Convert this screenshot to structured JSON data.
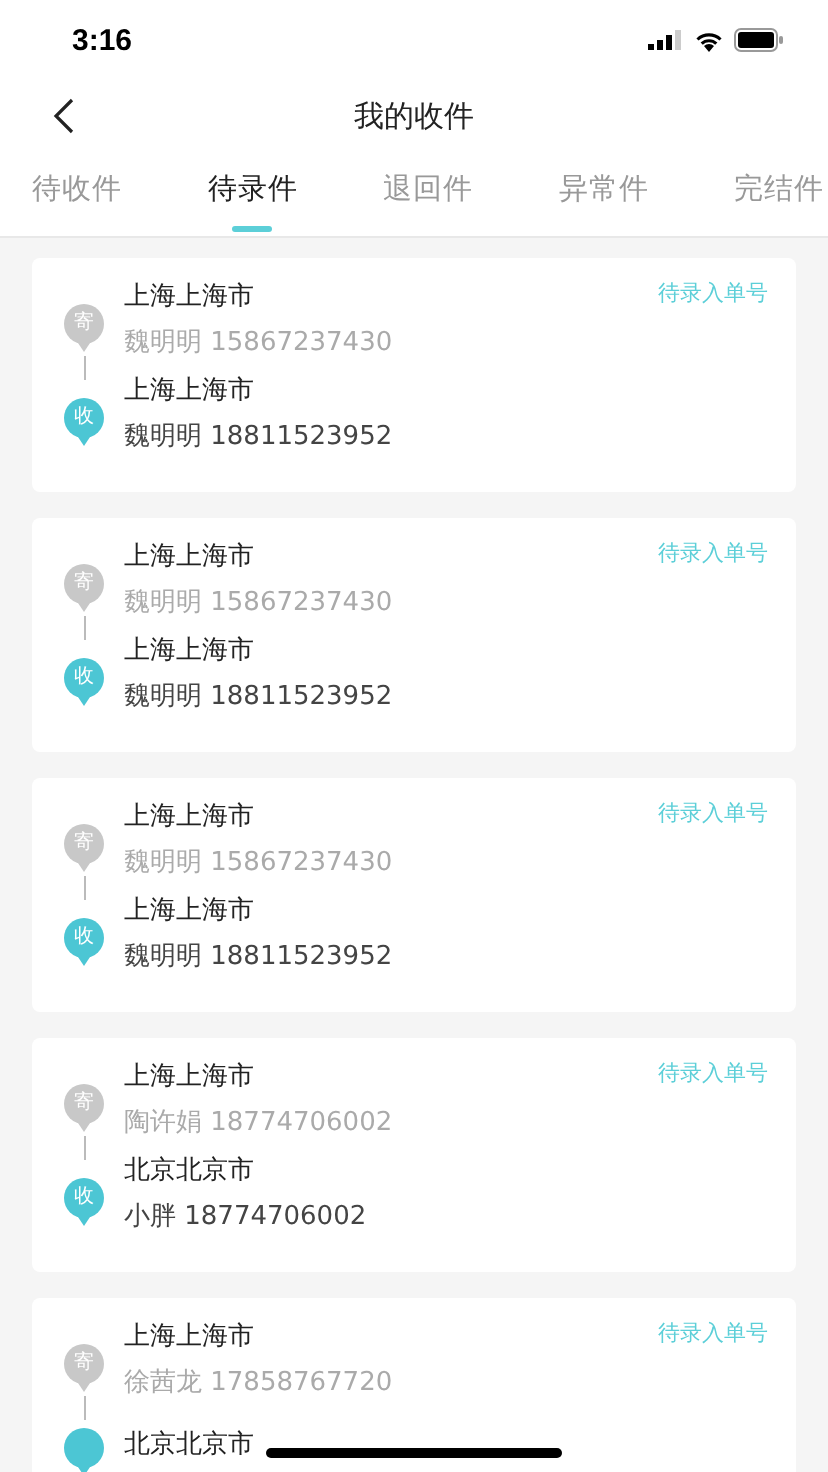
{
  "status_bar": {
    "time": "3:16"
  },
  "nav": {
    "title": "我的收件"
  },
  "tabs": [
    {
      "label": "待收件",
      "selected": false
    },
    {
      "label": "待录件",
      "selected": true
    },
    {
      "label": "退回件",
      "selected": false
    },
    {
      "label": "异常件",
      "selected": false
    },
    {
      "label": "完结件",
      "selected": false
    }
  ],
  "parcels": [
    {
      "status": "待录入单号",
      "stops": [
        {
          "kind": "sender",
          "badge": "寄",
          "city": "上海上海市",
          "contact": "魏明明 15867237430"
        },
        {
          "kind": "receiver",
          "badge": "收",
          "city": "上海上海市",
          "contact": "魏明明 18811523952"
        }
      ]
    },
    {
      "status": "待录入单号",
      "stops": [
        {
          "kind": "sender",
          "badge": "寄",
          "city": "上海上海市",
          "contact": "魏明明 15867237430"
        },
        {
          "kind": "receiver",
          "badge": "收",
          "city": "上海上海市",
          "contact": "魏明明 18811523952"
        }
      ]
    },
    {
      "status": "待录入单号",
      "stops": [
        {
          "kind": "sender",
          "badge": "寄",
          "city": "上海上海市",
          "contact": "魏明明 15867237430"
        },
        {
          "kind": "receiver",
          "badge": "收",
          "city": "上海上海市",
          "contact": "魏明明 18811523952"
        }
      ]
    },
    {
      "status": "待录入单号",
      "stops": [
        {
          "kind": "sender",
          "badge": "寄",
          "city": "上海上海市",
          "contact": "陶许娟 18774706002"
        },
        {
          "kind": "receiver",
          "badge": "收",
          "city": "北京北京市",
          "contact": "小胖 18774706002"
        }
      ]
    },
    {
      "status": "待录入单号",
      "stops": [
        {
          "kind": "sender",
          "badge": "寄",
          "city": "上海上海市",
          "contact": "徐茜龙 17858767720"
        },
        {
          "kind": "receiver",
          "city": "北京北京市"
        }
      ]
    }
  ]
}
